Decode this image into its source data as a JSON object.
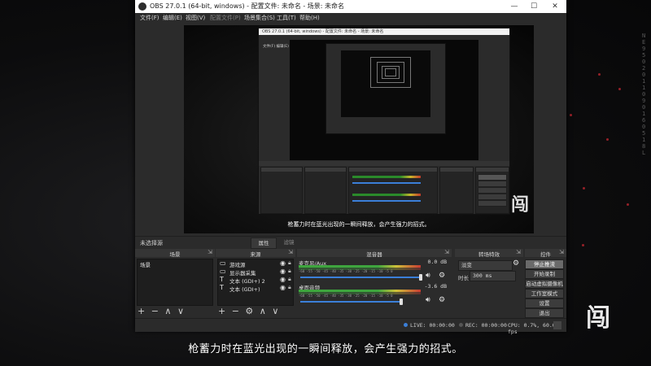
{
  "window": {
    "title": "OBS 27.0.1 (64-bit, windows) - 配置文件: 未命名 - 场景: 未命名",
    "minimize": "—",
    "maximize": "☐",
    "close": "✕"
  },
  "menu": [
    {
      "label": "文件(F)"
    },
    {
      "label": "编辑(E)"
    },
    {
      "label": "视图(V)"
    },
    {
      "label": "配置文件(P)"
    },
    {
      "label": "场景集合(S)"
    },
    {
      "label": "工具(T)"
    },
    {
      "label": "帮助(H)"
    }
  ],
  "preview": {
    "subtitle": "枪蓄力时在蓝光出现的一瞬间释放，会产生强力的招式。",
    "logo_glyph": "闯",
    "nested_title": "OBS 27.0.1 (64-bit, windows) - 配置文件: 未命名 - 场景: 未命名",
    "nested_menu": "文件(F)  编辑(E)  视图(V)  配置文件(P)  场景集合(S)  工具(T)  帮助(H)"
  },
  "strip": {
    "no_selection": "未选择源",
    "properties": "属性",
    "filters": "滤镜"
  },
  "scenes": {
    "title": "场景",
    "items": [
      {
        "label": "场景"
      }
    ],
    "footer": "+ − ∧ ∨"
  },
  "sources": {
    "title": "来源",
    "items": [
      {
        "icon": "▭",
        "label": "游戏源"
      },
      {
        "icon": "▭",
        "label": "显示器采集"
      },
      {
        "icon": "T",
        "label": "文本 (GDI+) 2"
      },
      {
        "icon": "T",
        "label": "文本 (GDI+)"
      }
    ],
    "footer": "+ − ⚙ ∧ ∨"
  },
  "mixer": {
    "title": "混音器",
    "channels": [
      {
        "name": "麦克风/Aux",
        "db": "0.0 dB"
      },
      {
        "name": "桌面音频",
        "db": "-3.6 dB"
      }
    ],
    "ticks": "-60 -55 -50 -45 -40 -35 -30 -25 -20 -15 -10 -5 0"
  },
  "transitions": {
    "title": "转场特效",
    "mode": "淡变",
    "duration_label": "时长",
    "duration": "300 ms"
  },
  "controls": {
    "title": "控件",
    "buttons": [
      {
        "label": "停止推流",
        "active": true
      },
      {
        "label": "开始录制",
        "active": false
      },
      {
        "label": "启动虚拟摄像机",
        "active": false
      },
      {
        "label": "工作室模式",
        "active": false
      },
      {
        "label": "设置",
        "active": false
      },
      {
        "label": "退出",
        "active": false
      }
    ]
  },
  "status": {
    "live": "LIVE: 00:00:00",
    "rec": "REC: 00:00:00",
    "cpu": "CPU: 0.7%, 60.00 fps"
  },
  "overlay": {
    "subtitle": "枪蓄力时在蓝光出现的一瞬间释放，会产生强力的招式。",
    "logo_glyph": "闯",
    "side_text": "NE9502011090160518L"
  },
  "colors": {
    "accent_blue": "#3b7fd8",
    "window_bg": "#2b2b2b",
    "meter_green": "#3ea53e",
    "meter_yellow": "#cfc13a",
    "meter_red": "#c83a32"
  }
}
